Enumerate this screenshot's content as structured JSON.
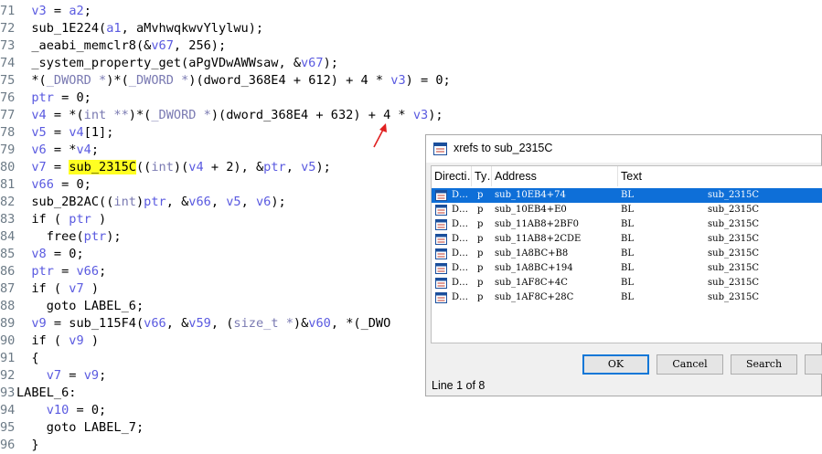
{
  "code_lines": [
    {
      "ln": "71",
      "parts": [
        {
          "t": "  "
        },
        {
          "t": "v3",
          "c": "v"
        },
        {
          "t": " = "
        },
        {
          "t": "a2",
          "c": "v"
        },
        {
          "t": ";"
        }
      ]
    },
    {
      "ln": "72",
      "parts": [
        {
          "t": "  sub_1E224("
        },
        {
          "t": "a1",
          "c": "v"
        },
        {
          "t": ", aMvhwqkwvYlylwu);"
        }
      ]
    },
    {
      "ln": "73",
      "parts": [
        {
          "t": "  _aeabi_memclr8(&"
        },
        {
          "t": "v67",
          "c": "v"
        },
        {
          "t": ", 256);"
        }
      ]
    },
    {
      "ln": "74",
      "parts": [
        {
          "t": "  _system_property_get(aPgVDwAWWsaw, &"
        },
        {
          "t": "v67",
          "c": "v"
        },
        {
          "t": ");"
        }
      ]
    },
    {
      "ln": "75",
      "parts": [
        {
          "t": "  *("
        },
        {
          "t": "_DWORD *",
          "c": "t"
        },
        {
          "t": ")*("
        },
        {
          "t": "_DWORD *",
          "c": "t"
        },
        {
          "t": ")(dword_368E4 + 612) + 4 * "
        },
        {
          "t": "v3",
          "c": "v"
        },
        {
          "t": ") = 0;"
        }
      ]
    },
    {
      "ln": "76",
      "parts": [
        {
          "t": "  "
        },
        {
          "t": "ptr",
          "c": "v"
        },
        {
          "t": " = 0;"
        }
      ]
    },
    {
      "ln": "77",
      "parts": [
        {
          "t": "  "
        },
        {
          "t": "v4",
          "c": "v"
        },
        {
          "t": " = *("
        },
        {
          "t": "int **",
          "c": "t"
        },
        {
          "t": ")*("
        },
        {
          "t": "_DWORD *",
          "c": "t"
        },
        {
          "t": ")(dword_368E4 + 632) + 4 * "
        },
        {
          "t": "v3",
          "c": "v"
        },
        {
          "t": ");"
        }
      ]
    },
    {
      "ln": "78",
      "parts": [
        {
          "t": "  "
        },
        {
          "t": "v5",
          "c": "v"
        },
        {
          "t": " = "
        },
        {
          "t": "v4",
          "c": "v"
        },
        {
          "t": "[1];"
        }
      ]
    },
    {
      "ln": "79",
      "parts": [
        {
          "t": "  "
        },
        {
          "t": "v6",
          "c": "v"
        },
        {
          "t": " = *"
        },
        {
          "t": "v4",
          "c": "v"
        },
        {
          "t": ";"
        }
      ]
    },
    {
      "ln": "80",
      "parts": [
        {
          "t": "  "
        },
        {
          "t": "v7",
          "c": "v"
        },
        {
          "t": " = "
        },
        {
          "t": "sub_2315C",
          "c": "hl"
        },
        {
          "t": "(("
        },
        {
          "t": "int",
          "c": "t"
        },
        {
          "t": ")("
        },
        {
          "t": "v4",
          "c": "v"
        },
        {
          "t": " + 2), &"
        },
        {
          "t": "ptr",
          "c": "v"
        },
        {
          "t": ", "
        },
        {
          "t": "v5",
          "c": "v"
        },
        {
          "t": ");"
        }
      ]
    },
    {
      "ln": "81",
      "parts": [
        {
          "t": "  "
        },
        {
          "t": "v66",
          "c": "v"
        },
        {
          "t": " = 0;"
        }
      ]
    },
    {
      "ln": "82",
      "parts": [
        {
          "t": "  sub_2B2AC(("
        },
        {
          "t": "int",
          "c": "t"
        },
        {
          "t": ")"
        },
        {
          "t": "ptr",
          "c": "v"
        },
        {
          "t": ", &"
        },
        {
          "t": "v66",
          "c": "v"
        },
        {
          "t": ", "
        },
        {
          "t": "v5",
          "c": "v"
        },
        {
          "t": ", "
        },
        {
          "t": "v6",
          "c": "v"
        },
        {
          "t": ");"
        }
      ]
    },
    {
      "ln": "83",
      "parts": [
        {
          "t": "  if ( "
        },
        {
          "t": "ptr",
          "c": "v"
        },
        {
          "t": " )"
        }
      ]
    },
    {
      "ln": "84",
      "parts": [
        {
          "t": "    free("
        },
        {
          "t": "ptr",
          "c": "v"
        },
        {
          "t": ");"
        }
      ]
    },
    {
      "ln": "85",
      "parts": [
        {
          "t": "  "
        },
        {
          "t": "v8",
          "c": "v"
        },
        {
          "t": " = 0;"
        }
      ]
    },
    {
      "ln": "86",
      "parts": [
        {
          "t": "  "
        },
        {
          "t": "ptr",
          "c": "v"
        },
        {
          "t": " = "
        },
        {
          "t": "v66",
          "c": "v"
        },
        {
          "t": ";"
        }
      ]
    },
    {
      "ln": "87",
      "parts": [
        {
          "t": "  if ( "
        },
        {
          "t": "v7",
          "c": "v"
        },
        {
          "t": " )"
        }
      ]
    },
    {
      "ln": "88",
      "parts": [
        {
          "t": "    goto LABEL_6;"
        }
      ]
    },
    {
      "ln": "89",
      "parts": [
        {
          "t": "  "
        },
        {
          "t": "v9",
          "c": "v"
        },
        {
          "t": " = sub_115F4("
        },
        {
          "t": "v66",
          "c": "v"
        },
        {
          "t": ", &"
        },
        {
          "t": "v59",
          "c": "v"
        },
        {
          "t": ", ("
        },
        {
          "t": "size_t *",
          "c": "t"
        },
        {
          "t": ")&"
        },
        {
          "t": "v60",
          "c": "v"
        },
        {
          "t": ", *(_DWO"
        }
      ]
    },
    {
      "ln": "90",
      "parts": [
        {
          "t": "  if ( "
        },
        {
          "t": "v9",
          "c": "v"
        },
        {
          "t": " )"
        }
      ]
    },
    {
      "ln": "91",
      "parts": [
        {
          "t": "  {"
        }
      ]
    },
    {
      "ln": "92",
      "parts": [
        {
          "t": "    "
        },
        {
          "t": "v7",
          "c": "v"
        },
        {
          "t": " = "
        },
        {
          "t": "v9",
          "c": "v"
        },
        {
          "t": ";"
        }
      ]
    },
    {
      "ln": "93",
      "parts": [
        {
          "t": "LABEL_6:"
        }
      ]
    },
    {
      "ln": "94",
      "parts": [
        {
          "t": "    "
        },
        {
          "t": "v10",
          "c": "v"
        },
        {
          "t": " = 0;"
        }
      ]
    },
    {
      "ln": "95",
      "parts": [
        {
          "t": "    goto LABEL_7;"
        }
      ]
    },
    {
      "ln": "96",
      "parts": [
        {
          "t": "  }"
        }
      ]
    }
  ],
  "dialog": {
    "title": "xrefs to sub_2315C",
    "columns": [
      "Directi…",
      "Ty…",
      "Address",
      "Text"
    ],
    "rows": [
      {
        "dir": "D…",
        "type": "p",
        "address": "sub_10EB4+74",
        "op": "BL",
        "target": "sub_2315C"
      },
      {
        "dir": "D…",
        "type": "p",
        "address": "sub_10EB4+E0",
        "op": "BL",
        "target": "sub_2315C"
      },
      {
        "dir": "D…",
        "type": "p",
        "address": "sub_11AB8+2BF0",
        "op": "BL",
        "target": "sub_2315C"
      },
      {
        "dir": "D…",
        "type": "p",
        "address": "sub_11AB8+2CDE",
        "op": "BL",
        "target": "sub_2315C"
      },
      {
        "dir": "D…",
        "type": "p",
        "address": "sub_1A8BC+B8",
        "op": "BL",
        "target": "sub_2315C"
      },
      {
        "dir": "D…",
        "type": "p",
        "address": "sub_1A8BC+194",
        "op": "BL",
        "target": "sub_2315C"
      },
      {
        "dir": "D…",
        "type": "p",
        "address": "sub_1AF8C+4C",
        "op": "BL",
        "target": "sub_2315C"
      },
      {
        "dir": "D…",
        "type": "p",
        "address": "sub_1AF8C+28C",
        "op": "BL",
        "target": "sub_2315C"
      }
    ],
    "selected_row": 0,
    "buttons": {
      "ok": "OK",
      "cancel": "Cancel",
      "search": "Search"
    },
    "status": "Line 1 of 8"
  },
  "icons": {
    "title": "xref-list-icon",
    "row": "xref-entry-icon",
    "annotation": "red-arrow-icon"
  },
  "colors": {
    "highlight": "#ffff22",
    "selection": "#0e6fd8",
    "keyword": "#0b0b8c",
    "variable": "#5a5ae0",
    "line_number": "#6c7a86",
    "arrow": "#e02020"
  }
}
